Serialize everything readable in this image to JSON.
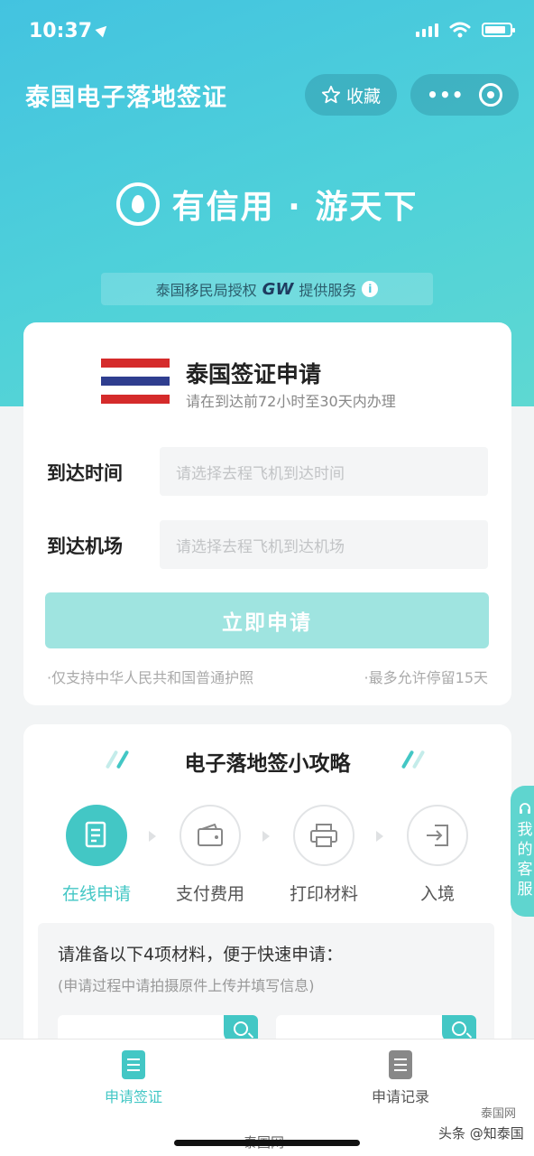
{
  "status": {
    "time": "10:37"
  },
  "nav": {
    "title": "泰国电子落地签证",
    "favorite": "收藏",
    "more": "•••"
  },
  "hero": {
    "slogan": "有信用 · 游天下",
    "auth_prefix": "泰国移民局授权",
    "auth_brand": "GW",
    "auth_suffix": "提供服务",
    "info": "i"
  },
  "apply_card": {
    "title": "泰国签证申请",
    "subtitle": "请在到达前72小时至30天内办理",
    "arrival_time_label": "到达时间",
    "arrival_time_placeholder": "请选择去程飞机到达时间",
    "arrival_airport_label": "到达机场",
    "arrival_airport_placeholder": "请选择去程飞机到达机场",
    "apply_button": "立即申请",
    "note_left": "·仅支持中华人民共和国普通护照",
    "note_right": "·最多允许停留15天"
  },
  "guide": {
    "title": "电子落地签小攻略",
    "steps": [
      {
        "label": "在线申请"
      },
      {
        "label": "支付费用"
      },
      {
        "label": "打印材料"
      },
      {
        "label": "入境"
      }
    ],
    "prep_title": "请准备以下4项材料，便于快速申请：",
    "prep_sub": "(申请过程中请拍摄原件上传并填写信息)"
  },
  "side_service": [
    "我",
    "的",
    "客",
    "服"
  ],
  "tabbar": {
    "apply": "申请签证",
    "records": "申请记录"
  },
  "watermarks": {
    "left": "泰国网",
    "right_prefix": "头条",
    "right_brand": "@知泰国",
    "right_top": "泰国网"
  },
  "colors": {
    "accent": "#43c7c5",
    "hero_start": "#43c3e0",
    "button_disabled": "#9fe4e0",
    "flag_red": "#d52b2b",
    "flag_blue": "#2f3e8f"
  }
}
